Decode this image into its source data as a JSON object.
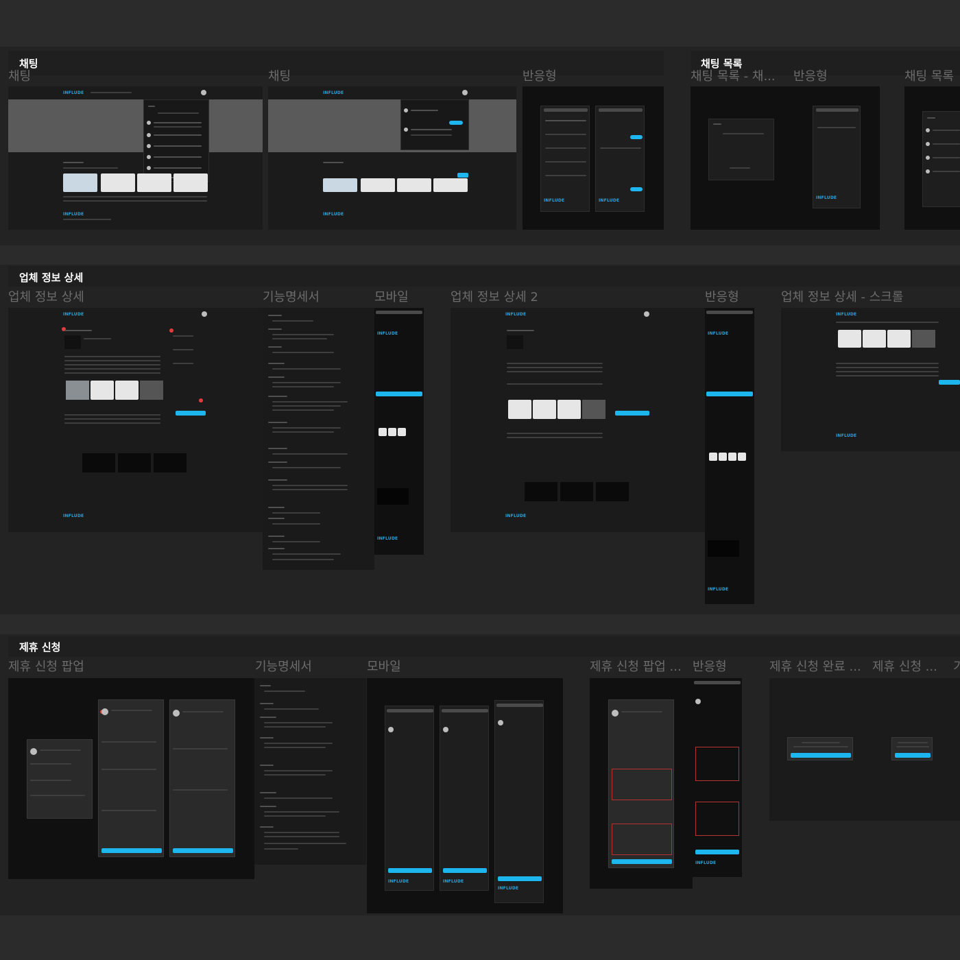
{
  "sections": {
    "chat": {
      "title": "채팅",
      "frames": [
        "채팅",
        "채팅",
        "반응형"
      ]
    },
    "chat_list": {
      "title": "채팅 목록",
      "frames": [
        "채팅 목록 - 채...",
        "반응형",
        "채팅 목록"
      ]
    },
    "company_detail": {
      "title": "업체 정보 상세",
      "frames": [
        "업체 정보 상세",
        "기능명세서",
        "모바일",
        "업체 정보 상세 2",
        "반응형",
        "업체 정보 상세 - 스크롤"
      ]
    },
    "partnership": {
      "title": "제휴 신청",
      "frames": [
        "제휴 신청 팝업",
        "기능명세서",
        "모바일",
        "제휴 신청 팝업 ...",
        "반응형",
        "제휴 신청 완료 ...",
        "제휴 신청 ...",
        "기"
      ]
    }
  },
  "screen_logo": "INFLUDE",
  "colors": {
    "accent": "#1eb6ee",
    "annotation": "#e53b3b",
    "background": "#2b2b2b",
    "band": "#232323",
    "frame": "#1b1b1b"
  },
  "icons": [
    "search-icon",
    "bell-icon",
    "avatar-icon",
    "share-icon"
  ]
}
